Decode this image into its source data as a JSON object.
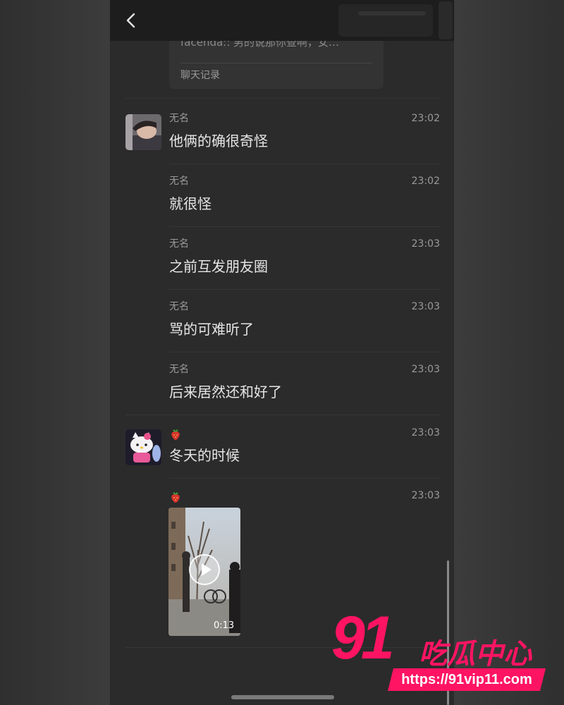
{
  "header": {
    "back_icon": "chevron-left-icon"
  },
  "record_card": {
    "preview": "facenda:: 男的说那你查啊，女…",
    "label": "聊天记录"
  },
  "messages": [
    {
      "sender": "无名",
      "time": "23:02",
      "text": "他俩的确很奇怪"
    },
    {
      "sender": "无名",
      "time": "23:02",
      "text": "就很怪"
    },
    {
      "sender": "无名",
      "time": "23:03",
      "text": "之前互发朋友圈"
    },
    {
      "sender": "无名",
      "time": "23:03",
      "text": "骂的可难听了"
    },
    {
      "sender": "无名",
      "time": "23:03",
      "text": "后来居然还和好了"
    },
    {
      "sender_icon": "strawberry-icon",
      "time": "23:03",
      "text": "冬天的时候"
    },
    {
      "sender_icon": "strawberry-icon",
      "time": "23:03",
      "video_duration": "0:13"
    }
  ],
  "watermark": {
    "number": "91",
    "name": "吃瓜中心",
    "url": "https://91vip11.com"
  },
  "colors": {
    "background": "#2b2b2b",
    "text_primary": "#e6e6e6",
    "text_secondary": "#9a9a9a",
    "watermark": "#ff1463"
  }
}
